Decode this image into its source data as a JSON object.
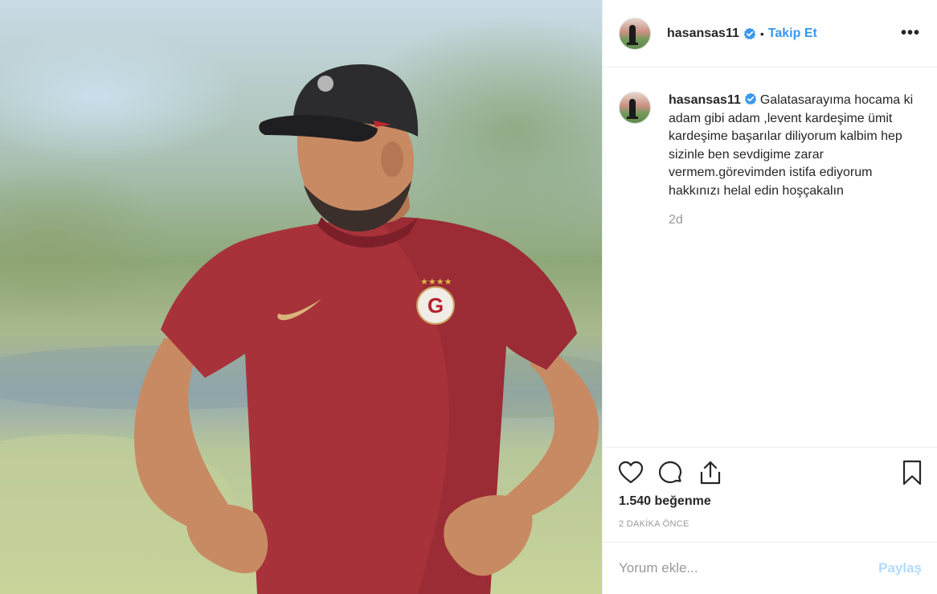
{
  "post": {
    "image_alt": "Man in red jersey and black cap",
    "account": {
      "username": "hasansas11",
      "verified": true,
      "separator": "•",
      "follow_label": "Takip Et",
      "more_label": "•••",
      "avatar_icon": "profile-photo"
    },
    "caption": {
      "username": "hasansas11",
      "text": "Galatasarayıma hocama ki adam gibi adam ,levent kardeşime ümit kardeşime başarılar diliyorum kalbim hep sizinle ben sevdigime zarar vermem.görevimden istifa ediyorum hakkınızı helal edin hoşçakalın",
      "relative_time": "2d"
    },
    "actions": {
      "like_icon": "heart-icon",
      "comment_icon": "comment-icon",
      "share_icon": "share-icon",
      "save_icon": "bookmark-icon"
    },
    "likes_text": "1.540 beğenme",
    "timestamp": "2 DAKİKA ÖNCE",
    "comment": {
      "placeholder": "Yorum ekle...",
      "value": "",
      "post_label": "Paylaş"
    }
  },
  "colors": {
    "link_blue": "#3897f0",
    "disabled_blue": "#b3dbff",
    "muted_gray": "#999999",
    "text": "#262626",
    "jersey_red": "#a8323a"
  }
}
